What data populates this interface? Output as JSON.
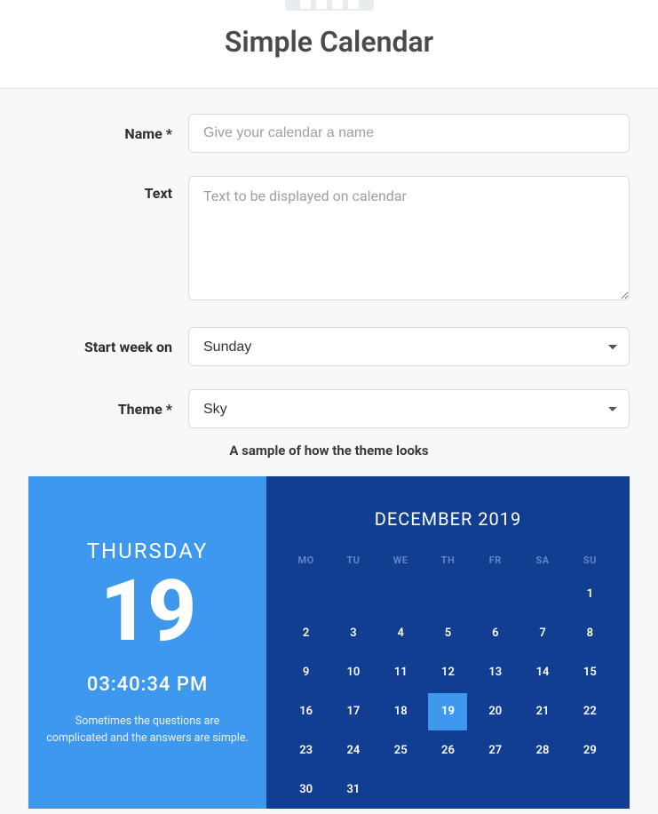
{
  "header": {
    "title": "Simple Calendar"
  },
  "form": {
    "name_label": "Name *",
    "name_placeholder": "Give your calendar a name",
    "text_label": "Text",
    "text_placeholder": "Text to be displayed on calendar",
    "start_week_label": "Start week on",
    "start_week_value": "Sunday",
    "theme_label": "Theme *",
    "theme_value": "Sky",
    "sample_caption": "A sample of how the theme looks"
  },
  "preview": {
    "left": {
      "dayname": "THURSDAY",
      "daynum": "19",
      "clock": "03:40:34 PM",
      "quote": "Sometimes the questions are complicated and the answers are simple."
    },
    "right": {
      "month_title": "DECEMBER 2019",
      "weekdays": [
        "MO",
        "TU",
        "WE",
        "TH",
        "FR",
        "SA",
        "SU"
      ],
      "leading_blanks": 6,
      "days": [
        "1",
        "2",
        "3",
        "4",
        "5",
        "6",
        "7",
        "8",
        "9",
        "10",
        "11",
        "12",
        "13",
        "14",
        "15",
        "16",
        "17",
        "18",
        "19",
        "20",
        "21",
        "22",
        "23",
        "24",
        "25",
        "26",
        "27",
        "28",
        "29",
        "30",
        "31"
      ],
      "today": "19"
    }
  },
  "colors": {
    "preview_left_bg": "#3e98ee",
    "preview_right_bg": "#123e91",
    "today_highlight": "#3e98ee",
    "weekday_header": "#5f86c9"
  }
}
